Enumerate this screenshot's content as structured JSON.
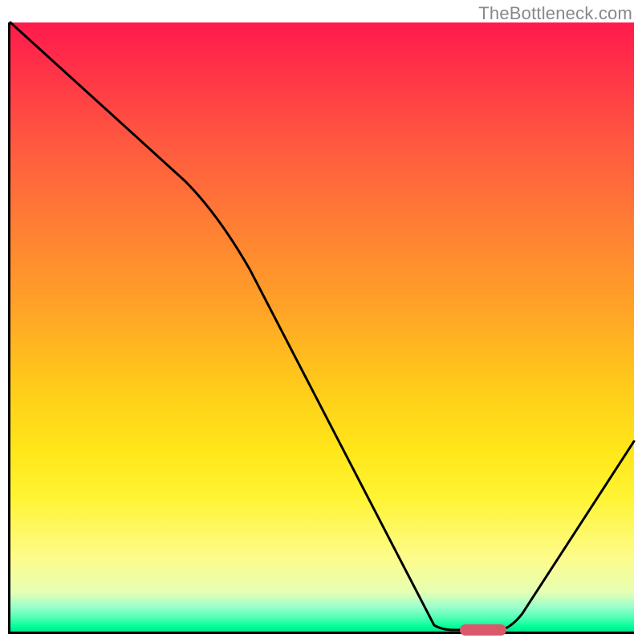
{
  "watermark": "TheBottleneck.com",
  "chart_data": {
    "type": "line",
    "title": "",
    "xlabel": "",
    "ylabel": "",
    "xlim": [
      0,
      100
    ],
    "ylim": [
      0,
      100
    ],
    "series": [
      {
        "name": "bottleneck-curve",
        "x": [
          0,
          28,
          68,
          73,
          78,
          100
        ],
        "y": [
          100,
          74,
          1,
          0,
          0,
          31
        ]
      }
    ],
    "annotations": [
      {
        "name": "optimal-marker",
        "x_range": [
          73,
          78
        ],
        "y": 0,
        "color": "#d9596b"
      }
    ],
    "background": "vertical-gradient red-orange-yellow-green"
  },
  "colors": {
    "curve": "#000000",
    "axis": "#000000",
    "marker": "#d9596b"
  }
}
